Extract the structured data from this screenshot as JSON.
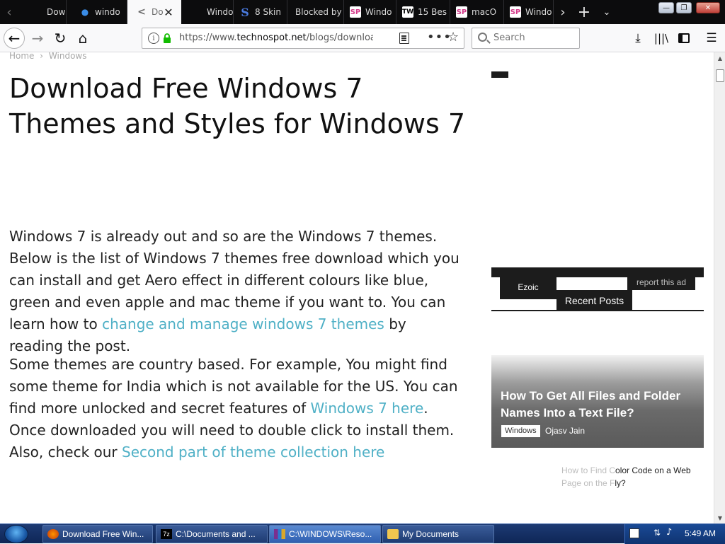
{
  "browser": {
    "tabs": [
      {
        "label": "Downl",
        "favicon": "generic-page-icon"
      },
      {
        "label": "windo",
        "favicon": "blue-dot-icon"
      },
      {
        "label": "Do",
        "favicon": "share-icon",
        "active": true
      },
      {
        "label": "Windo",
        "favicon": "generic-page-icon"
      },
      {
        "label": "8 Skin",
        "favicon": "s-logo-icon"
      },
      {
        "label": "Blocked by",
        "favicon": "generic-page-icon"
      },
      {
        "label": "Windo",
        "favicon": "sp-logo-icon"
      },
      {
        "label": "15 Bes",
        "favicon": "tw-logo-icon"
      },
      {
        "label": "macO",
        "favicon": "sp-logo-icon"
      },
      {
        "label": "Windo",
        "favicon": "sp-logo-icon"
      }
    ],
    "url": {
      "prefix": "https://www.",
      "host": "technospot.net",
      "path": "/blogs/download-fr"
    },
    "search": {
      "placeholder": "Search"
    }
  },
  "page": {
    "breadcrumb": {
      "home": "Home",
      "separator": "›",
      "category": "Windows"
    },
    "title": "Download Free Windows 7 Themes and Styles for Windows 7",
    "paragraph1": {
      "text": "Windows 7 is already out and so are the Windows 7 themes. Below is the list of  Windows 7 themes free download which you can install and get Aero effect in different colours like blue, green and even apple and mac theme if you want to. You can learn how to ",
      "link": "change and manage windows 7 themes",
      "after": " by reading the post."
    },
    "paragraph2": {
      "text1": "Some themes are country based. For example, You might find some theme for India which is not available for the US. You can find more unlocked and secret features of ",
      "link1": "Windows 7 here",
      "text2": ". Once downloaded you will need to double click to install them. Also, check our ",
      "link2": "Second part of theme collection here"
    }
  },
  "sidebar": {
    "ezoic_label": "Ezoic",
    "report_ad": "report this ad",
    "recent_posts": "Recent Posts",
    "featured": {
      "title": "How To Get All Files and Folder Names Into a Text File?",
      "category": "Windows",
      "author": "Ojasv Jain"
    },
    "next_post": {
      "light1": "How to Find C",
      "dark1": "olor Code on a Web",
      "light2": "Page on the F",
      "dark2": "ly?"
    }
  },
  "taskbar": {
    "items": [
      {
        "label": "Download Free Win...",
        "icon": "firefox-icon"
      },
      {
        "label": "C:\\Documents and ...",
        "icon": "7zip-icon"
      },
      {
        "label": "C:\\WINDOWS\\Reso...",
        "icon": "winrar-icon",
        "active": true
      },
      {
        "label": "My Documents",
        "icon": "folder-icon"
      }
    ],
    "clock": "5:49 AM"
  },
  "colors": {
    "link": "#4fb0c6",
    "tabstrip": "#0c0c0d",
    "sidebar_dark": "#1c1c1c",
    "taskbar": "#1d3a73"
  }
}
